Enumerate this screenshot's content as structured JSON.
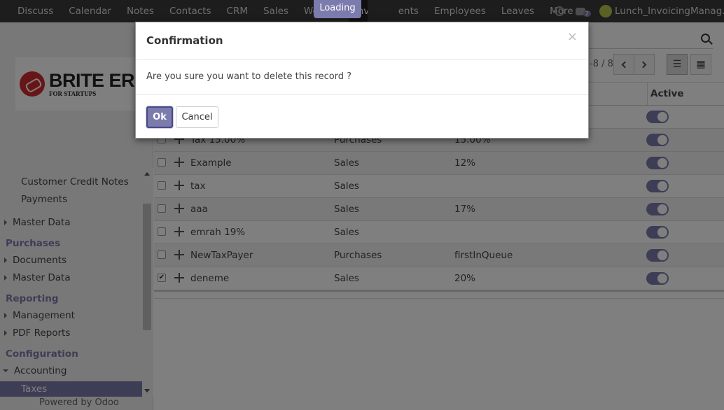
{
  "navbar": {
    "menu_items": [
      "Discuss",
      "Calendar",
      "Notes",
      "Contacts",
      "CRM",
      "Sales",
      "Website",
      "Inv",
      "ents",
      "Employees",
      "Leaves",
      "More"
    ],
    "chat_badge": "2",
    "user_name": "Lunch_InvoicingManag..."
  },
  "loading_label": "Loading",
  "control_panel": {
    "pager_text": "-8 / 8"
  },
  "sidebar": {
    "logo_text": "BRITE ERP",
    "logo_subtext": "FOR STARTUPS",
    "items": {
      "customer_credit_notes": "Customer Credit Notes",
      "payments": "Payments",
      "master_data_1": "Master Data",
      "purchases": "Purchases",
      "documents": "Documents",
      "master_data_2": "Master Data",
      "reporting": "Reporting",
      "management": "Management",
      "pdf_reports": "PDF Reports",
      "configuration": "Configuration",
      "accounting": "Accounting",
      "taxes": "Taxes"
    },
    "powered_by": "Powered by Odoo"
  },
  "table": {
    "active_header": "Active",
    "rows": [
      {
        "name": "",
        "scope": "",
        "amount": "",
        "checked": false,
        "active": true
      },
      {
        "name": "Tax 15.00%",
        "scope": "Purchases",
        "amount": "15.00%",
        "checked": false,
        "active": true
      },
      {
        "name": "Example",
        "scope": "Sales",
        "amount": "12%",
        "checked": false,
        "active": true
      },
      {
        "name": "tax",
        "scope": "Sales",
        "amount": "",
        "checked": false,
        "active": true
      },
      {
        "name": "aaa",
        "scope": "Sales",
        "amount": "17%",
        "checked": false,
        "active": true
      },
      {
        "name": "emrah 19%",
        "scope": "Sales",
        "amount": "",
        "checked": false,
        "active": true
      },
      {
        "name": "NewTaxPayer",
        "scope": "Purchases",
        "amount": "firstInQueue",
        "checked": false,
        "active": true
      },
      {
        "name": "deneme",
        "scope": "Sales",
        "amount": "20%",
        "checked": true,
        "active": true
      }
    ]
  },
  "dialog": {
    "title": "Confirmation",
    "close_symbol": "×",
    "message": "Are you sure you want to delete this record ?",
    "ok_label": "Ok",
    "cancel_label": "Cancel"
  },
  "colors": {
    "accent": "#7c7bad",
    "navbar": "#3a3a3a",
    "logo_red": "#d12a2f"
  }
}
